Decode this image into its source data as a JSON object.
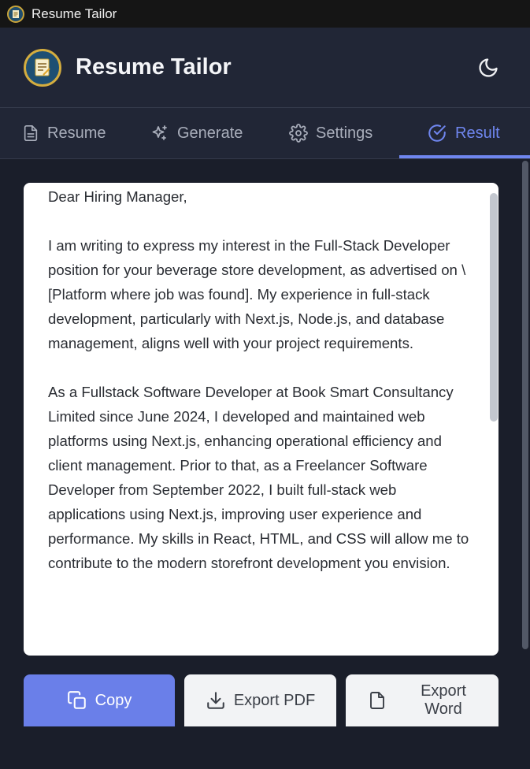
{
  "window": {
    "title": "Resume Tailor"
  },
  "header": {
    "app_name": "Resume Tailor"
  },
  "tabs": [
    {
      "label": "Resume",
      "icon": "document-icon"
    },
    {
      "label": "Generate",
      "icon": "sparkles-icon"
    },
    {
      "label": "Settings",
      "icon": "gear-icon"
    },
    {
      "label": "Result",
      "icon": "check-circle-icon",
      "active": true
    }
  ],
  "letter": {
    "text": "Dear Hiring Manager,\n\nI am writing to express my interest in the Full-Stack Developer position for your beverage store development, as advertised on \\[Platform where job was found]. My experience in full-stack development, particularly with Next.js, Node.js, and database management, aligns well with your project requirements.\n\nAs a Fullstack Software Developer at Book Smart Consultancy Limited since June 2024, I developed and maintained web platforms using Next.js, enhancing operational efficiency and client management. Prior to that, as a Freelancer Software Developer from September 2022, I built full-stack web applications using Next.js, improving user experience and performance. My skills in React, HTML, and CSS will allow me to contribute to the modern storefront development you envision."
  },
  "actions": {
    "copy": "Copy",
    "export_pdf": "Export PDF",
    "export_word": "Export Word"
  },
  "colors": {
    "accent": "#6f86ef",
    "background": "#1a1e2a",
    "header": "#212636"
  }
}
